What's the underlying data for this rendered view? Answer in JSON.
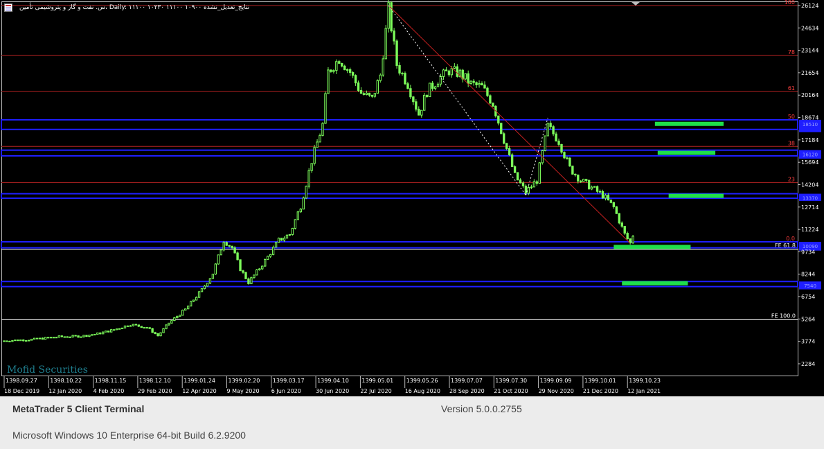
{
  "window": {
    "header_title": "س. نفت و گاز و پتروشیمی تأمین، Daily: ۱۱۱۰۰ ۱۰۲۳۰ ۱۱۱۰۰ ۱۰۹۰۰ نتایج_تعدیل_نشده",
    "icon": "chart-window-icon",
    "watermark": "Mofid Securities"
  },
  "footer": {
    "app_name": "MetaTrader 5 Client Terminal",
    "version": "Version 5.0.0.2755",
    "os": "Microsoft Windows 10 Enterprise 64-bit Build 6.2.9200"
  },
  "colors": {
    "background": "#000000",
    "bull": "#7cfc5a",
    "bear": "#7cfc5a",
    "fib": "#b22222",
    "blue_zone": "#1f1fff",
    "green_zone": "#1fe04a",
    "axis_text": "#ffffff",
    "fe_line": "#ffffff"
  },
  "chart_data": {
    "type": "candlestick",
    "yaxis_ticks": [
      26124,
      24634,
      23144,
      21654,
      20164,
      18674,
      17184,
      15694,
      14204,
      12714,
      11224,
      9734,
      8244,
      6754,
      5264,
      3774,
      2284
    ],
    "ylim": [
      1500,
      26400
    ],
    "x_top_labels": [
      "1398.09.27",
      "1398.10.22",
      "1398.11.15",
      "1398.12.10",
      "1399.01.24",
      "1399.02.20",
      "1399.03.17",
      "1399.04.10",
      "1399.05.01",
      "1399.05.26",
      "1399.07.07",
      "1399.07.30",
      "1399.09.09",
      "1399.10.01",
      "1399.10.23"
    ],
    "x_bottom_labels": [
      "18 Dec 2019",
      "12 Jan 2020",
      "4 Feb 2020",
      "29 Feb 2020",
      "12 Apr 2020",
      "9 May 2020",
      "6 Jun 2020",
      "30 Jun 2020",
      "22 Jul 2020",
      "16 Aug 2020",
      "28 Sep 2020",
      "21 Oct 2020",
      "29 Nov 2020",
      "21 Dec 2020",
      "12 Jan 2021"
    ],
    "fib_levels": [
      {
        "label": "100",
        "price": 26124
      },
      {
        "label": "78",
        "price": 22800
      },
      {
        "label": "61",
        "price": 20400
      },
      {
        "label": "50",
        "price": 18520
      },
      {
        "label": "38",
        "price": 16750
      },
      {
        "label": "23",
        "price": 14350
      },
      {
        "label": "0.0",
        "price": 10400
      }
    ],
    "fe_levels": [
      {
        "label": "FE 61.8",
        "price": 9900
      },
      {
        "label": "FE 100.0",
        "price": 5215
      }
    ],
    "blue_zones": [
      {
        "high": 18520,
        "low": 17880,
        "left_label": "",
        "right_label": "18510"
      },
      {
        "high": 16500,
        "low": 16120,
        "left_label": "",
        "right_label": "16120"
      },
      {
        "high": 13600,
        "low": 13300,
        "left_label": "",
        "right_label": "13370"
      },
      {
        "high": 10400,
        "low": 10000,
        "left_label": "",
        "right_label": "10090"
      },
      {
        "high": 7760,
        "low": 7420,
        "left_label": "",
        "right_label": "7540"
      }
    ],
    "green_zones": [
      {
        "start": 237,
        "end": 262,
        "price": 18250
      },
      {
        "start": 238,
        "end": 259,
        "price": 16320
      },
      {
        "start": 242,
        "end": 262,
        "price": 13460
      },
      {
        "start": 222,
        "end": 250,
        "price": 10060
      },
      {
        "start": 225,
        "end": 249,
        "price": 7640
      }
    ],
    "trend_lines": [
      {
        "from_index": 140,
        "from_price": 26124,
        "to_index": 228,
        "to_price": 10300,
        "style": "solid"
      },
      {
        "from_index": 140,
        "from_price": 26124,
        "to_index": 190,
        "to_price": 13500,
        "style": "dotted"
      },
      {
        "from_index": 190,
        "from_price": 13500,
        "to_index": 198,
        "to_price": 18650,
        "style": "dotted"
      }
    ],
    "close_path": [
      [
        0,
        3810
      ],
      [
        10,
        3900
      ],
      [
        20,
        4080
      ],
      [
        28,
        4120
      ],
      [
        34,
        4280
      ],
      [
        40,
        4550
      ],
      [
        46,
        4900
      ],
      [
        52,
        4700
      ],
      [
        56,
        4150
      ],
      [
        60,
        5000
      ],
      [
        66,
        5900
      ],
      [
        72,
        7200
      ],
      [
        76,
        8300
      ],
      [
        80,
        10500
      ],
      [
        83,
        10000
      ],
      [
        86,
        8600
      ],
      [
        89,
        7700
      ],
      [
        92,
        8400
      ],
      [
        96,
        9400
      ],
      [
        100,
        10500
      ],
      [
        104,
        10900
      ],
      [
        108,
        12800
      ],
      [
        112,
        15800
      ],
      [
        116,
        18200
      ],
      [
        118,
        21700
      ],
      [
        122,
        22600
      ],
      [
        126,
        21700
      ],
      [
        130,
        20300
      ],
      [
        134,
        19900
      ],
      [
        137,
        21500
      ],
      [
        140,
        25900
      ],
      [
        143,
        22200
      ],
      [
        147,
        20900
      ],
      [
        151,
        18900
      ],
      [
        154,
        20400
      ],
      [
        158,
        21200
      ],
      [
        162,
        21800
      ],
      [
        166,
        21600
      ],
      [
        170,
        20900
      ],
      [
        174,
        20700
      ],
      [
        178,
        19600
      ],
      [
        182,
        17200
      ],
      [
        186,
        14800
      ],
      [
        190,
        13700
      ],
      [
        194,
        14500
      ],
      [
        198,
        18100
      ],
      [
        202,
        17100
      ],
      [
        206,
        15300
      ],
      [
        210,
        14500
      ],
      [
        214,
        14000
      ],
      [
        218,
        13500
      ],
      [
        222,
        12700
      ],
      [
        226,
        10900
      ],
      [
        228,
        10300
      ],
      [
        229,
        10850
      ]
    ]
  }
}
